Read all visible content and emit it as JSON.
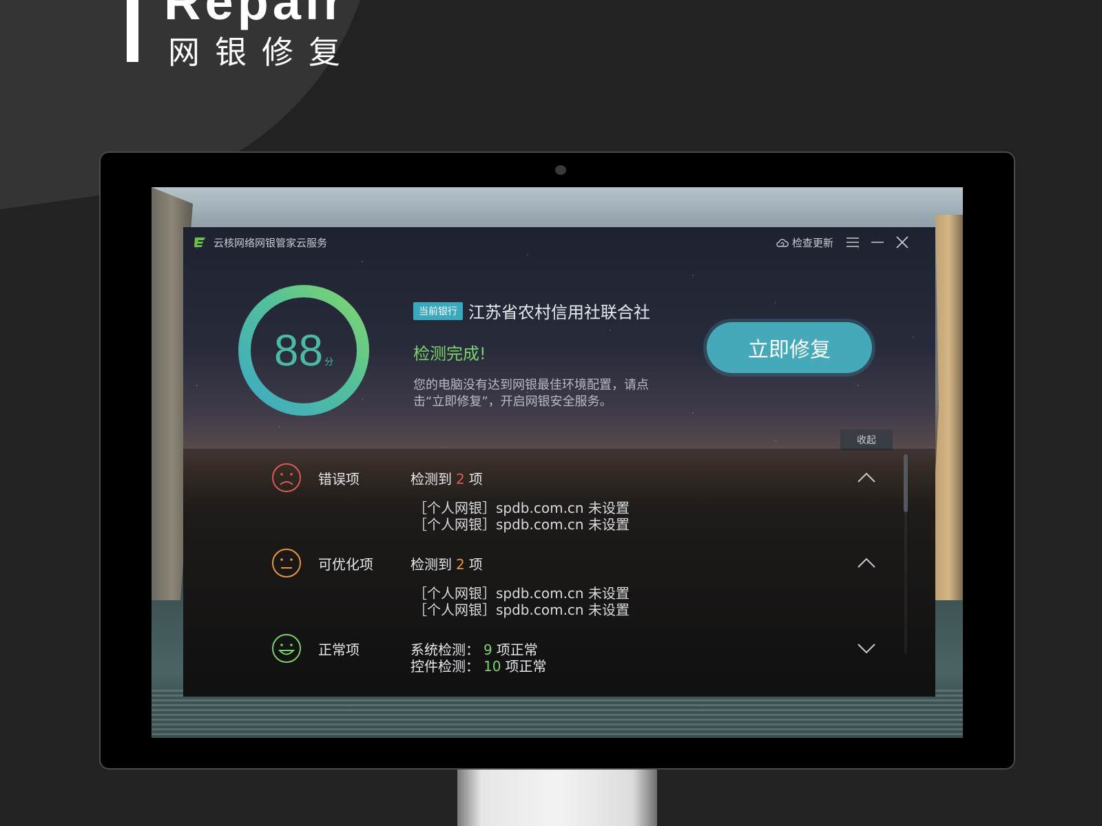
{
  "hero": {
    "title_en": "Repair",
    "title_cn": "网银修复"
  },
  "app": {
    "title": "云核网络网银管家云服务",
    "check_update": "检查更新",
    "score": "88",
    "score_unit": "分",
    "score_fraction": 0.88,
    "bank_badge": "当前银行",
    "bank_name": "江苏省农村信用社联合社",
    "status_title": "检测完成!",
    "status_desc": "您的电脑没有达到网银最佳环境配置，请点击“立即修复”，开启网银安全服务。",
    "repair_button": "立即修复",
    "collapse": "收起",
    "colors": {
      "accent": "#45a9b9",
      "success": "#7bd36a",
      "error": "#e05a55",
      "warning": "#e89a3c"
    }
  },
  "sections": {
    "error": {
      "label": "错误项",
      "prefix": "检测到",
      "count": "2",
      "suffix": "项",
      "items": [
        "［个人网银］spdb.com.cn 未设置",
        "［个人网银］spdb.com.cn 未设置"
      ]
    },
    "optimize": {
      "label": "可优化项",
      "prefix": "检测到",
      "count": "2",
      "suffix": "项",
      "items": [
        "［个人网银］spdb.com.cn 未设置",
        "［个人网银］spdb.com.cn 未设置"
      ]
    },
    "normal": {
      "label": "正常项",
      "system_prefix": "系统检测：",
      "system_count": "9",
      "system_suffix": "项正常",
      "control_prefix": "控件检测：",
      "control_count": "10",
      "control_suffix": "项正常"
    }
  }
}
